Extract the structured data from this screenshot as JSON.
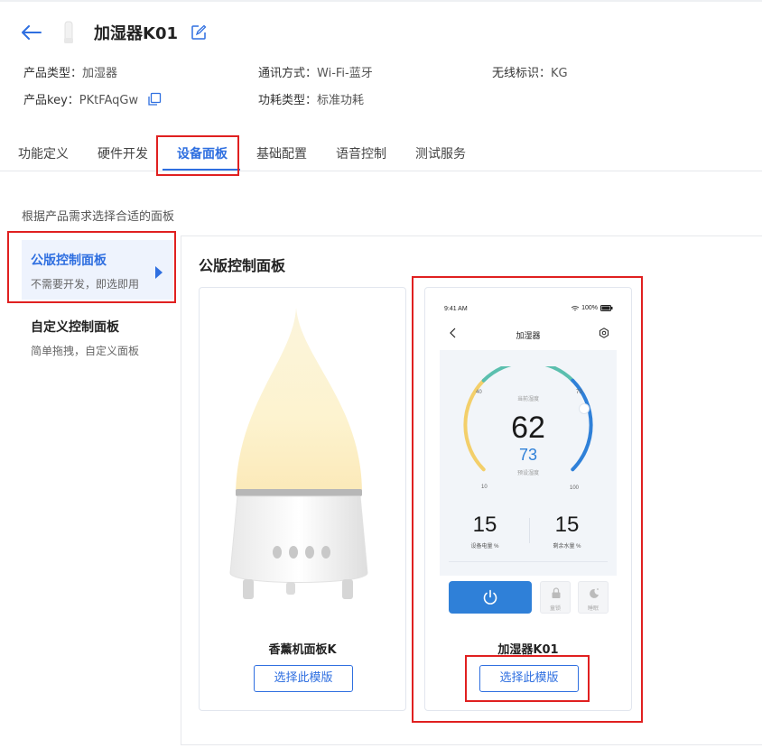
{
  "header": {
    "title": "加湿器K01"
  },
  "meta": {
    "product_type_label": "产品类型：",
    "product_type_value": "加湿器",
    "comm_label": "通讯方式：",
    "comm_value": "Wi-Fi-蓝牙",
    "wireless_label": "无线标识：",
    "wireless_value": "KG",
    "key_label": "产品key：",
    "key_value": "PKtFAqGw",
    "power_label": "功耗类型：",
    "power_value": "标准功耗"
  },
  "tabs": [
    {
      "label": "功能定义"
    },
    {
      "label": "硬件开发"
    },
    {
      "label": "设备面板"
    },
    {
      "label": "基础配置"
    },
    {
      "label": "语音控制"
    },
    {
      "label": "测试服务"
    }
  ],
  "hint": "根据产品需求选择合适的面板",
  "side_menu": [
    {
      "title": "公版控制面板",
      "subtitle": "不需要开发，即选即用"
    },
    {
      "title": "自定义控制面板",
      "subtitle": "简单拖拽，自定义面板"
    }
  ],
  "panel_title": "公版控制面板",
  "cards": [
    {
      "name": "香薰机面板K",
      "button": "选择此模版"
    },
    {
      "name": "加湿器K01",
      "button": "选择此模版"
    }
  ],
  "phone": {
    "time": "9:41 AM",
    "battery": "100%",
    "title": "加湿器",
    "current_caption": "当前湿度",
    "current_value": "62",
    "set_value": "73",
    "set_caption": "预设湿度",
    "tick_40": "40",
    "tick_70": "70",
    "tick_10": "10",
    "tick_100": "100",
    "stat1_value": "15",
    "stat1_caption": "设备电量 %",
    "stat2_value": "15",
    "stat2_caption": "剩余水量 %",
    "lock_caption": "童锁",
    "sleep_caption": "睡眠"
  },
  "colors": {
    "accent": "#2f6fe0",
    "highlight_box": "#e02020",
    "gauge_teal": "#5bbfae",
    "gauge_yellow": "#f3cf6a",
    "gauge_blue": "#2f80d8"
  }
}
